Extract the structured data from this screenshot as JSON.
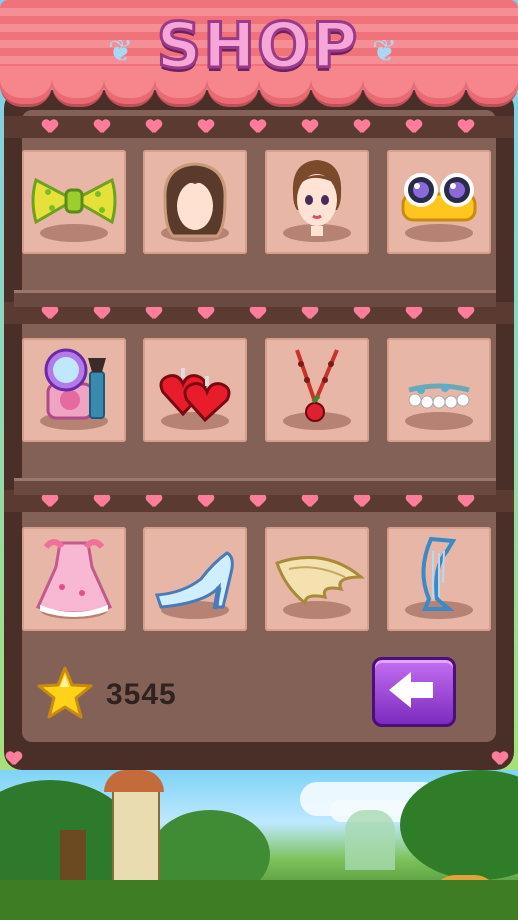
{
  "header": {
    "title": "SHOP"
  },
  "wallet": {
    "star_count": "3545",
    "icon": "star-icon"
  },
  "nav": {
    "back_icon": "arrow-left-icon"
  },
  "shelves": [
    {
      "items": [
        "bow-icon",
        "hair-icon",
        "face-icon",
        "glasses-icon"
      ]
    },
    {
      "items": [
        "makeup-icon",
        "earrings-icon",
        "necklace-icon",
        "bracelet-icon"
      ]
    },
    {
      "items": [
        "dress-icon",
        "shoe-icon",
        "wings-icon",
        "harp-icon"
      ]
    }
  ],
  "colors": {
    "slot": "#e8b6a6",
    "cabinet": "#4a2f28",
    "awning": "#f0727a",
    "back_button": "#a04fe0",
    "heart": "#ff7d9a"
  }
}
